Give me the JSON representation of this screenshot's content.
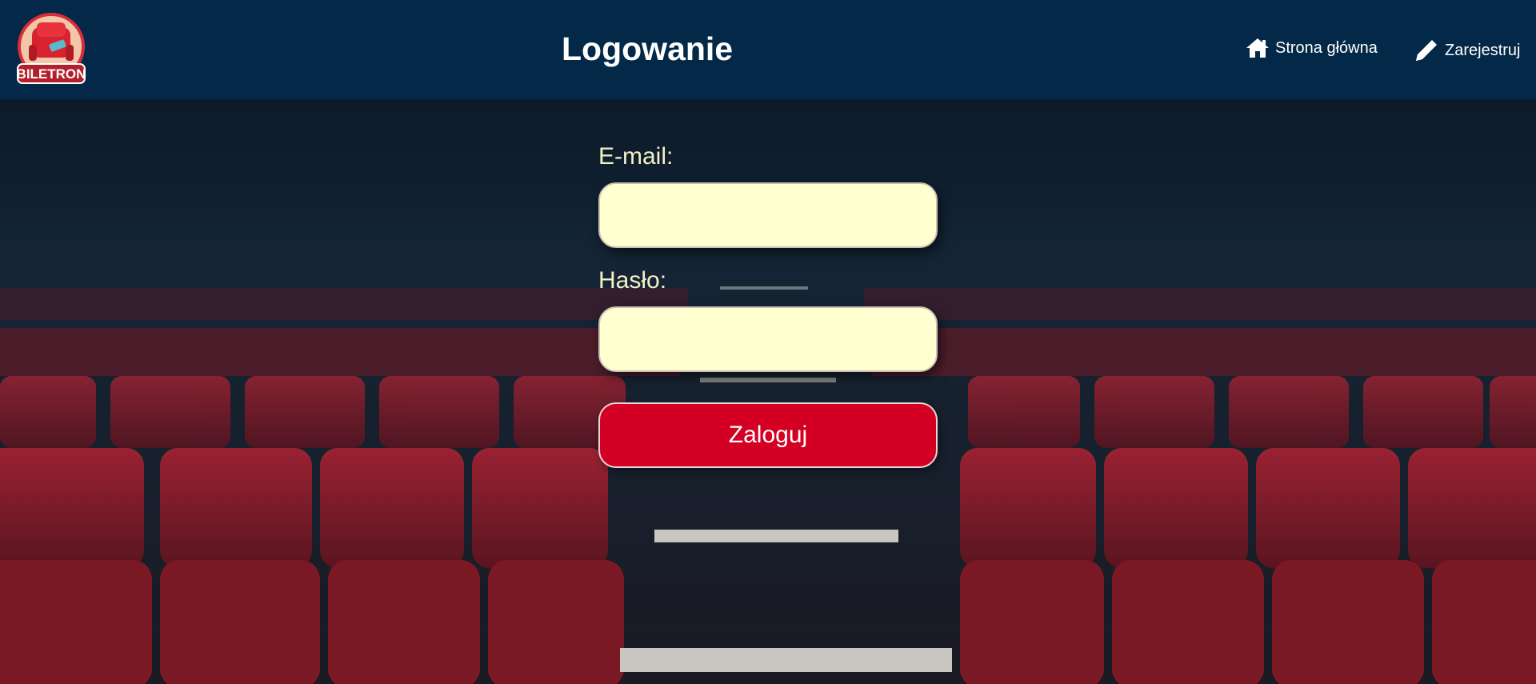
{
  "brand": {
    "logo_text": "BILETRON"
  },
  "header": {
    "title": "Logowanie",
    "nav": [
      {
        "label": "Strona główna",
        "icon": "home-icon"
      },
      {
        "label": "Zarejestruj",
        "icon": "pencil-icon"
      }
    ]
  },
  "login_form": {
    "email_label": "E-mail:",
    "email_value": "",
    "password_label": "Hasło:",
    "password_value": "",
    "submit_label": "Zaloguj"
  },
  "colors": {
    "header_bg": "#032848",
    "input_bg": "#ffffcf",
    "button_bg": "#d30023",
    "label_text": "#f4f0c8",
    "seat_red": "#8a1c28"
  }
}
